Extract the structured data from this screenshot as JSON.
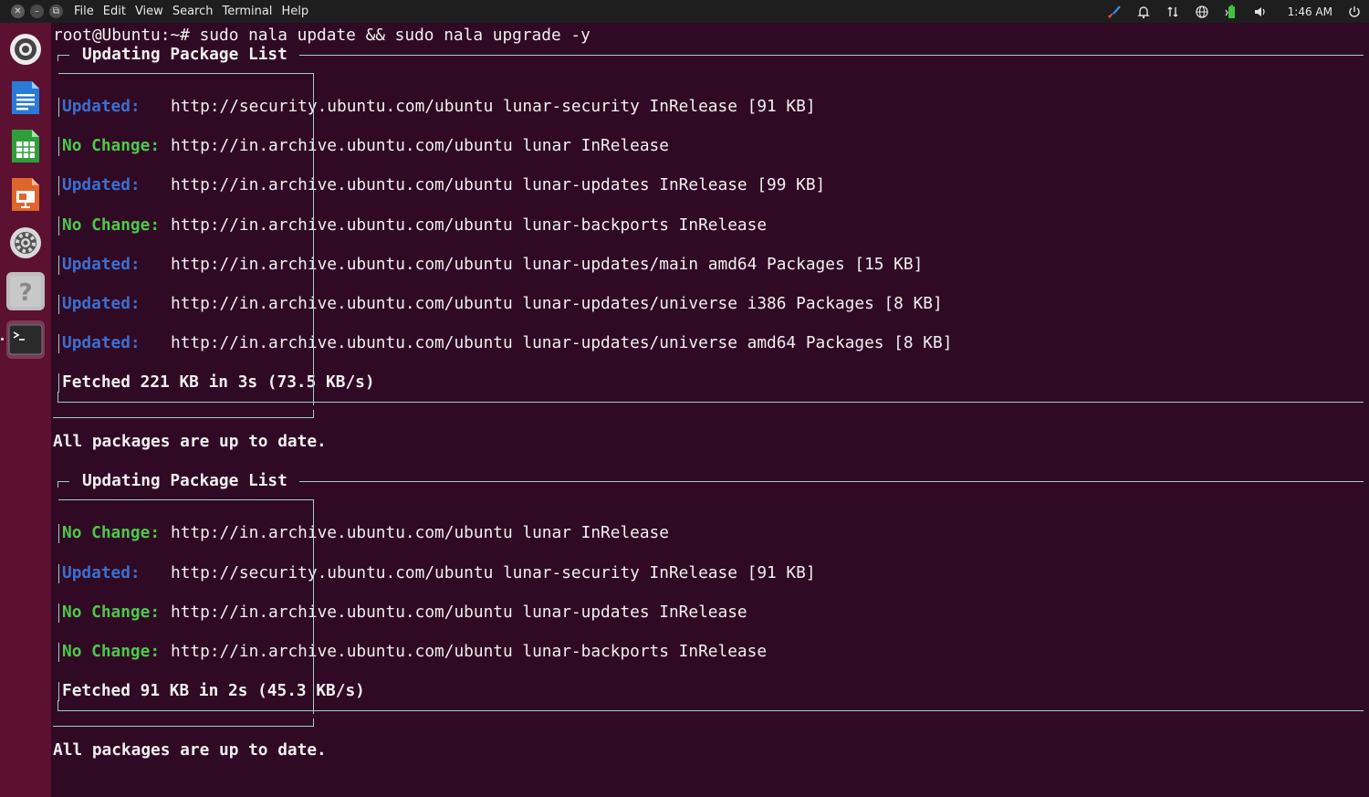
{
  "topbar": {
    "window_buttons": [
      {
        "name": "close-window-button",
        "glyph": "✕"
      },
      {
        "name": "minimize-window-button",
        "glyph": "–"
      },
      {
        "name": "restore-window-button",
        "glyph": "⧉"
      }
    ],
    "menu": [
      "File",
      "Edit",
      "View",
      "Search",
      "Terminal",
      "Help"
    ],
    "clock": "1:46 AM",
    "tray_icons": [
      "brush-icon",
      "bell-icon",
      "sync-icon",
      "globe-icon",
      "battery-icon",
      "volume-icon",
      "power-icon"
    ]
  },
  "dock": {
    "apps": [
      {
        "name": "ubuntu-updater",
        "icon": "lifebuoy-icon"
      },
      {
        "name": "libreoffice-writer",
        "icon": "writer-icon"
      },
      {
        "name": "libreoffice-calc",
        "icon": "calc-icon"
      },
      {
        "name": "libreoffice-impress",
        "icon": "impress-icon"
      },
      {
        "name": "settings",
        "icon": "gear-icon"
      },
      {
        "name": "help",
        "icon": "help-icon"
      },
      {
        "name": "terminal",
        "icon": "terminal-icon",
        "glyph": ">_",
        "active": true
      }
    ]
  },
  "terminal": {
    "command_line": "root@Ubuntu:~# sudo nala update && sudo nala upgrade -y",
    "sections": [
      {
        "title": "Updating Package List",
        "entries": [
          {
            "status": "Updated:",
            "text": "http://security.ubuntu.com/ubuntu lunar-security InRelease [91 KB]"
          },
          {
            "status": "No Change:",
            "text": "http://in.archive.ubuntu.com/ubuntu lunar InRelease"
          },
          {
            "status": "Updated:",
            "text": "http://in.archive.ubuntu.com/ubuntu lunar-updates InRelease [99 KB]"
          },
          {
            "status": "No Change:",
            "text": "http://in.archive.ubuntu.com/ubuntu lunar-backports InRelease"
          },
          {
            "status": "Updated:",
            "text": "http://in.archive.ubuntu.com/ubuntu lunar-updates/main amd64 Packages [15 KB]"
          },
          {
            "status": "Updated:",
            "text": "http://in.archive.ubuntu.com/ubuntu lunar-updates/universe i386 Packages [8 KB]"
          },
          {
            "status": "Updated:",
            "text": "http://in.archive.ubuntu.com/ubuntu lunar-updates/universe amd64 Packages [8 KB]"
          }
        ],
        "fetched": "Fetched 221 KB in 3s (73.5 KB/s)",
        "result": "All packages are up to date."
      },
      {
        "title": "Updating Package List",
        "entries": [
          {
            "status": "No Change:",
            "text": "http://in.archive.ubuntu.com/ubuntu lunar InRelease"
          },
          {
            "status": "Updated:",
            "text": "http://security.ubuntu.com/ubuntu lunar-security InRelease [91 KB]"
          },
          {
            "status": "No Change:",
            "text": "http://in.archive.ubuntu.com/ubuntu lunar-updates InRelease"
          },
          {
            "status": "No Change:",
            "text": "http://in.archive.ubuntu.com/ubuntu lunar-backports InRelease"
          }
        ],
        "fetched": "Fetched 91 KB in 2s (45.3 KB/s)",
        "result": "All packages are up to date."
      }
    ]
  },
  "colors": {
    "terminal_bg": "#300a24",
    "dock_bg": "#5c1130",
    "updated": "#3b6fd0",
    "no_change": "#4cc94c",
    "frame": "#9fd0c8"
  }
}
